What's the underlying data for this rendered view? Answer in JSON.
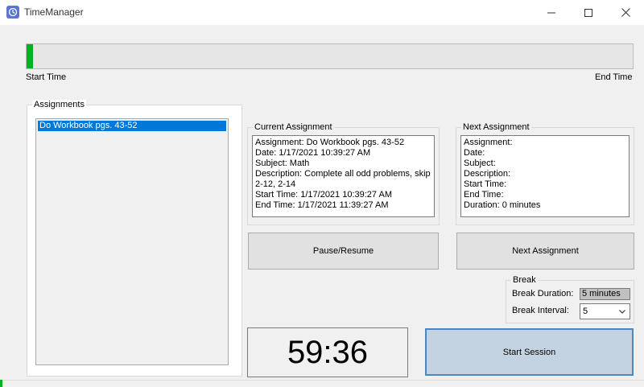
{
  "window": {
    "title": "TimeManager",
    "icon": "clock-icon",
    "controls": {
      "minimize": "minimize-icon",
      "maximize": "maximize-icon",
      "close": "close-icon"
    }
  },
  "progress": {
    "value_fraction": 0.01,
    "fill_color": "#06b025",
    "start_label": "Start Time",
    "end_label": "End Time"
  },
  "assignments": {
    "legend": "Assignments",
    "items": [
      "Do Workbook pgs. 43-52"
    ],
    "selected_index": 0
  },
  "current_assignment": {
    "legend": "Current Assignment",
    "lines": [
      "Assignment: Do Workbook pgs. 43-52",
      "Date: 1/17/2021 10:39:27 AM",
      "Subject: Math",
      "Description: Complete all odd problems, skip 2-12, 2-14",
      "Start Time: 1/17/2021 10:39:27 AM",
      "End Time: 1/17/2021 11:39:27 AM"
    ]
  },
  "next_assignment": {
    "legend": "Next Assignment",
    "lines": [
      "Assignment:",
      "Date:",
      "Subject:",
      "Description:",
      "Start Time:",
      "End Time:",
      "Duration: 0 minutes"
    ]
  },
  "buttons": {
    "pause_resume": "Pause/Resume",
    "next_assignment": "Next Assignment",
    "start_session": "Start Session"
  },
  "break": {
    "legend": "Break",
    "duration_label": "Break Duration:",
    "duration_value": "5 minutes",
    "interval_label": "Break Interval:",
    "interval_value": "5"
  },
  "timer": {
    "display": "59:36"
  },
  "colors": {
    "accent": "#0078d7",
    "progress": "#06b025",
    "start_button": "#c4d3e1"
  }
}
